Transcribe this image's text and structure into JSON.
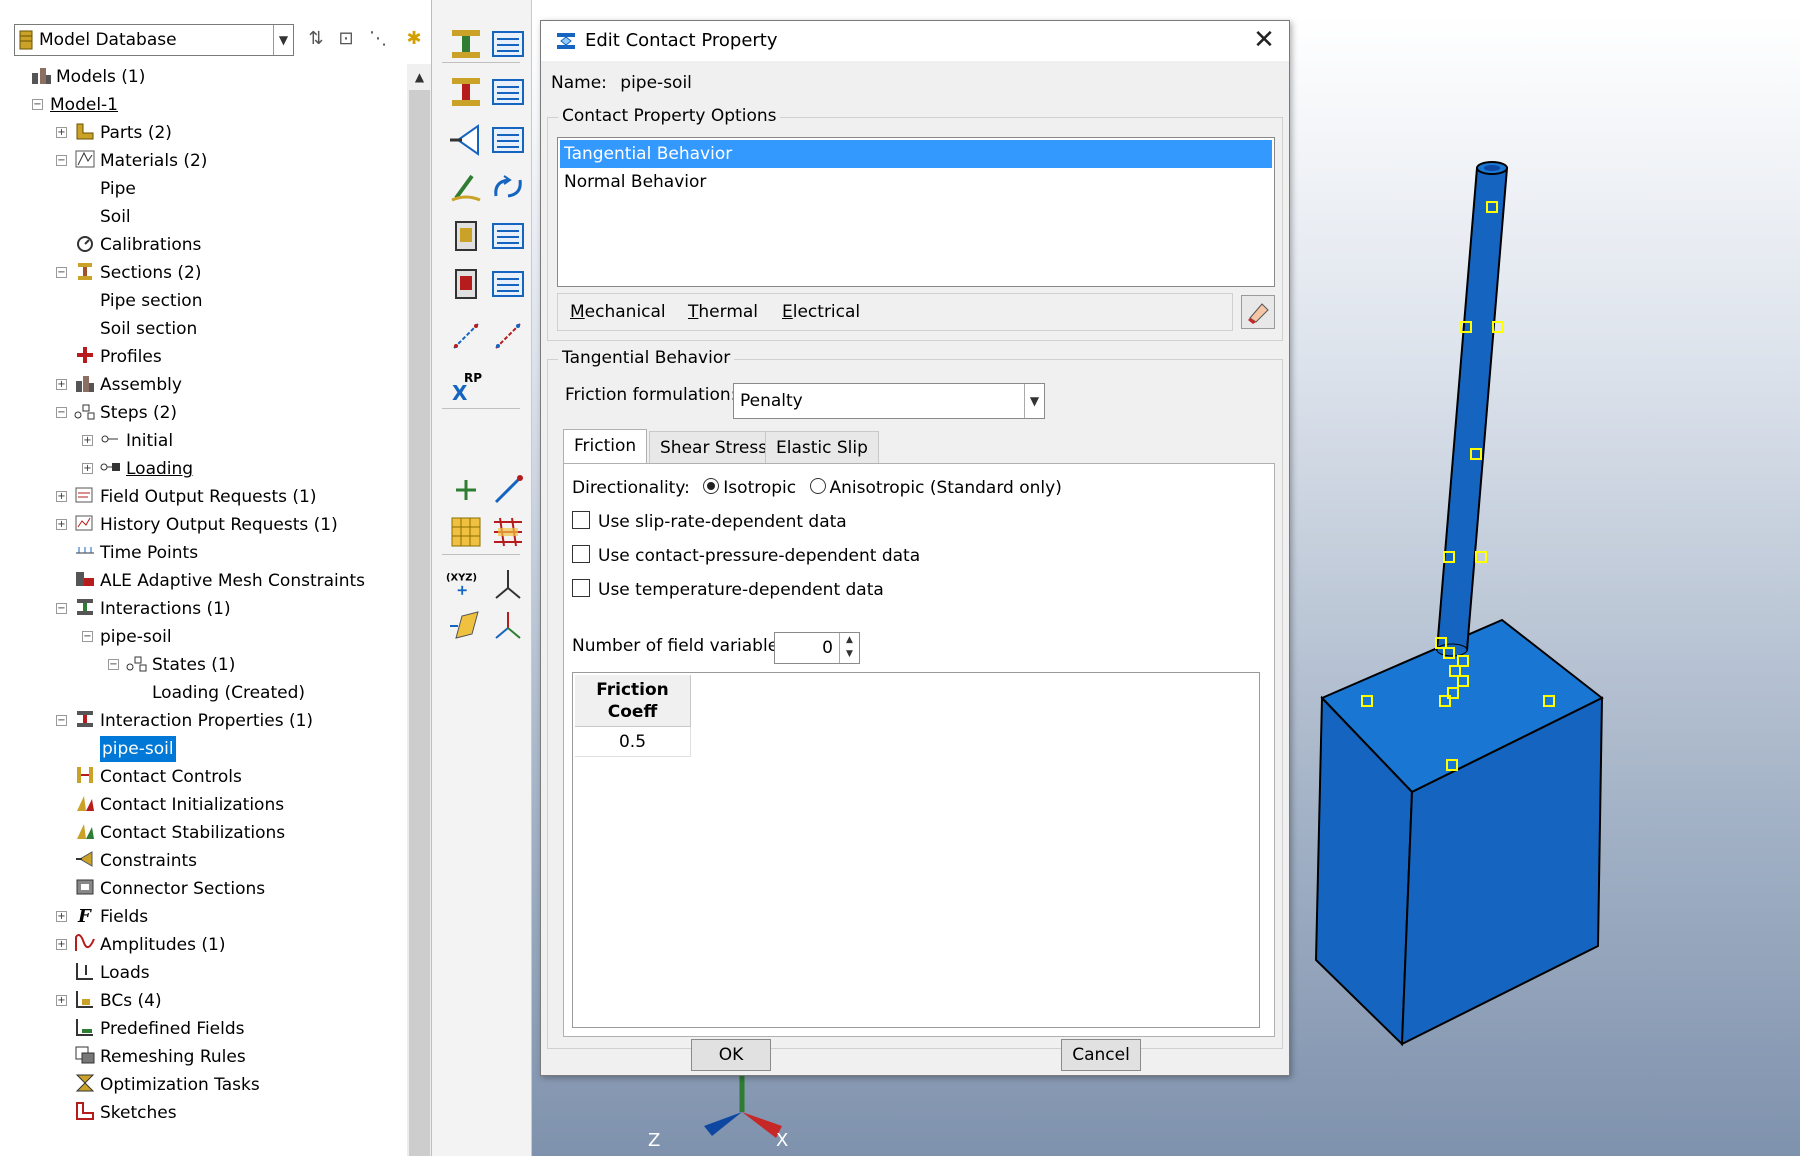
{
  "tree": {
    "selector_label": "Model Database",
    "items": [
      {
        "label": "Models (1)"
      },
      {
        "label": "Model-1"
      },
      {
        "label": "Parts (2)"
      },
      {
        "label": "Materials (2)"
      },
      {
        "label": "Pipe"
      },
      {
        "label": "Soil"
      },
      {
        "label": "Calibrations"
      },
      {
        "label": "Sections (2)"
      },
      {
        "label": "Pipe section"
      },
      {
        "label": "Soil section"
      },
      {
        "label": "Profiles"
      },
      {
        "label": "Assembly"
      },
      {
        "label": "Steps (2)"
      },
      {
        "label": "Initial"
      },
      {
        "label": "Loading"
      },
      {
        "label": "Field Output Requests (1)"
      },
      {
        "label": "History Output Requests (1)"
      },
      {
        "label": "Time Points"
      },
      {
        "label": "ALE Adaptive Mesh Constraints"
      },
      {
        "label": "Interactions (1)"
      },
      {
        "label": "pipe-soil"
      },
      {
        "label": "States (1)"
      },
      {
        "label": "Loading (Created)"
      },
      {
        "label": "Interaction Properties (1)"
      },
      {
        "label": "pipe-soil"
      },
      {
        "label": "Contact Controls"
      },
      {
        "label": "Contact Initializations"
      },
      {
        "label": "Contact Stabilizations"
      },
      {
        "label": "Constraints"
      },
      {
        "label": "Connector Sections"
      },
      {
        "label": "Fields"
      },
      {
        "label": "Amplitudes (1)"
      },
      {
        "label": "Loads"
      },
      {
        "label": "BCs (4)"
      },
      {
        "label": "Predefined Fields"
      },
      {
        "label": "Remeshing Rules"
      },
      {
        "label": "Optimization Tasks"
      },
      {
        "label": "Sketches"
      }
    ]
  },
  "toolbox": {
    "rp_label": "RP",
    "xyz_label": "(XYZ)"
  },
  "viewport": {
    "triad_z": "Z",
    "triad_x": "X",
    "model_color": "#1565c0",
    "marker_color": "#ffff00"
  },
  "dialog": {
    "title": "Edit Contact Property",
    "name_label": "Name:",
    "name_value": "pipe-soil",
    "options_group_title": "Contact Property Options",
    "options": [
      "Tangential Behavior",
      "Normal Behavior"
    ],
    "menu": {
      "mechanical": {
        "u": "M",
        "rest": "echanical"
      },
      "thermal": {
        "u": "T",
        "rest": "hermal"
      },
      "electrical": {
        "u": "E",
        "rest": "lectrical"
      }
    },
    "behavior_group_title": "Tangential Behavior",
    "friction_formulation_label": "Friction formulation:",
    "friction_formulation_value": "Penalty",
    "tabs": [
      "Friction",
      "Shear Stress",
      "Elastic Slip"
    ],
    "directionality_label": "Directionality:",
    "isotropic_label": "Isotropic",
    "anisotropic_label": "Anisotropic (Standard only)",
    "checkboxes": [
      "Use slip-rate-dependent data",
      "Use contact-pressure-dependent data",
      "Use temperature-dependent data"
    ],
    "field_variables_label": "Number of field variables:",
    "field_variables_value": "0",
    "table": {
      "header_line1": "Friction",
      "header_line2": "Coeff",
      "value": "0.5"
    },
    "ok_label": "OK",
    "cancel_label": "Cancel"
  }
}
